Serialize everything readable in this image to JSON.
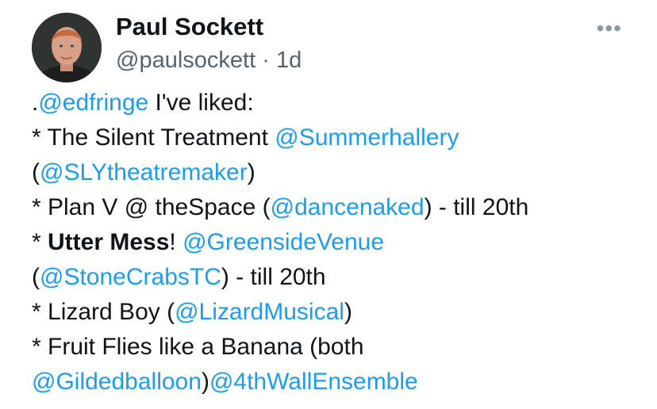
{
  "tweet": {
    "author_name": "Paul Sockett",
    "handle": "@paulsockett",
    "separator": "·",
    "time": "1d",
    "more_icon": "ellipsis-icon",
    "colors": {
      "mention": "#1d9bf0",
      "text": "#0f1419",
      "muted": "#536471"
    },
    "lines": [
      {
        "p0": ".",
        "m0": "@edfringe",
        "p1": " I've liked:"
      },
      {
        "p0": "* The Silent Treatment ",
        "m0": "@Summerhallery"
      },
      {
        "p0": "(",
        "m0": "@SLYtheatremaker",
        "p1": ")"
      },
      {
        "p0": "* Plan V @ theSpace (",
        "m0": "@dancenaked",
        "p1": ") - till 20th"
      },
      {
        "p0": "* ",
        "b0": "Utter Mess",
        "p1": "! ",
        "m0": "@GreensideVenue"
      },
      {
        "p0": "(",
        "m0": "@StoneCrabsTC",
        "p1": ") - till 20th"
      },
      {
        "p0": "* Lizard Boy (",
        "m0": "@LizardMusical",
        "p1": ")"
      },
      {
        "p0": "* Fruit Flies like a Banana (both"
      },
      {
        "m0": "@Gildedballoon",
        "p0": ")",
        "m1": "@4thWallEnsemble"
      }
    ]
  }
}
